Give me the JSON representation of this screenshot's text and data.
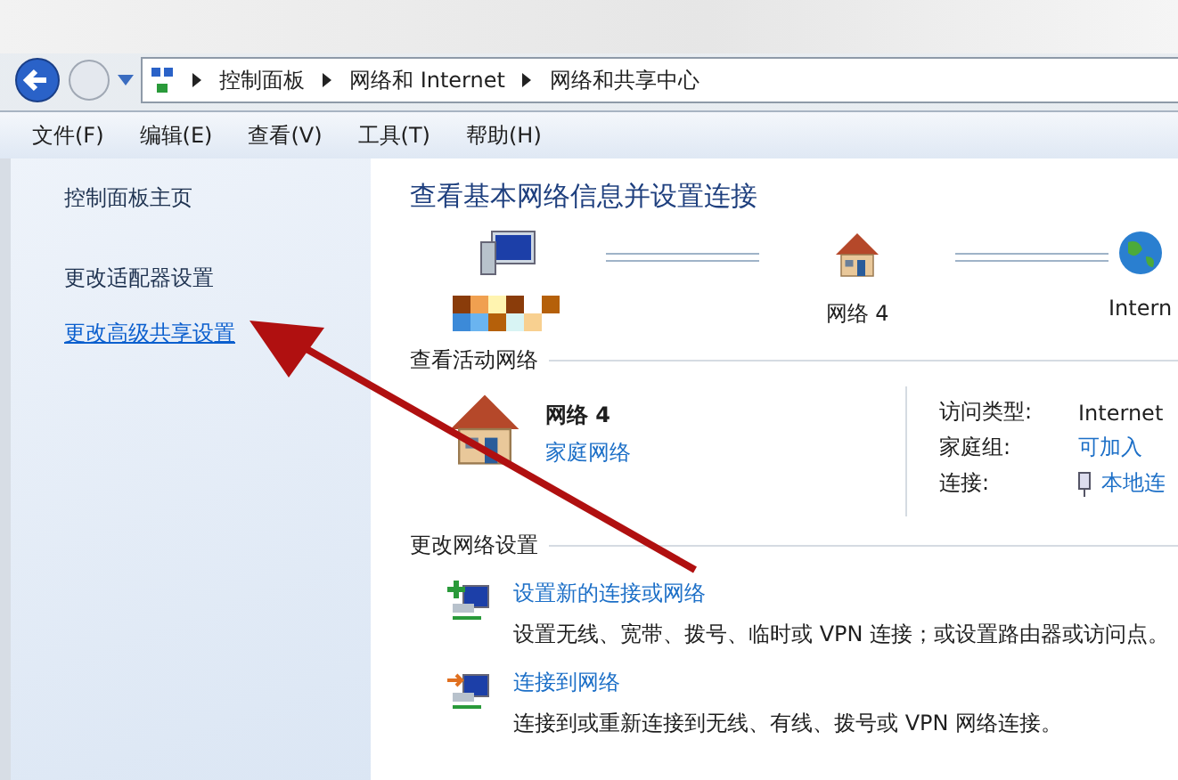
{
  "breadcrumb": [
    "控制面板",
    "网络和 Internet",
    "网络和共享中心"
  ],
  "menu": [
    "文件(F)",
    "编辑(E)",
    "查看(V)",
    "工具(T)",
    "帮助(H)"
  ],
  "sidebar": {
    "items": [
      {
        "label": "控制面板主页",
        "hovered": false
      },
      {
        "label": "更改适配器设置",
        "hovered": false
      },
      {
        "label": "更改高级共享设置",
        "hovered": true
      }
    ]
  },
  "main": {
    "title": "查看基本网络信息并设置连接",
    "map": [
      {
        "kind": "computer"
      },
      {
        "kind": "house",
        "label": "网络  4"
      },
      {
        "kind": "globe",
        "label": "Intern"
      }
    ],
    "active_heading": "查看活动网络",
    "network": {
      "name": "网络  4",
      "type": "家庭网络"
    },
    "details": [
      {
        "label": "访问类型:",
        "value": "Internet",
        "kind": "text"
      },
      {
        "label": "家庭组:",
        "value": "可加入",
        "kind": "link"
      },
      {
        "label": "连接:",
        "value": "本地连",
        "kind": "plug-link"
      }
    ],
    "settings_heading": "更改网络设置",
    "tasks": [
      {
        "title": "设置新的连接或网络",
        "desc": "设置无线、宽带、拨号、临时或 VPN 连接；或设置路由器或访问点。",
        "kind": "new"
      },
      {
        "title": "连接到网络",
        "desc": "连接到或重新连接到无线、有线、拨号或 VPN 网络连接。",
        "kind": "connect"
      }
    ]
  }
}
